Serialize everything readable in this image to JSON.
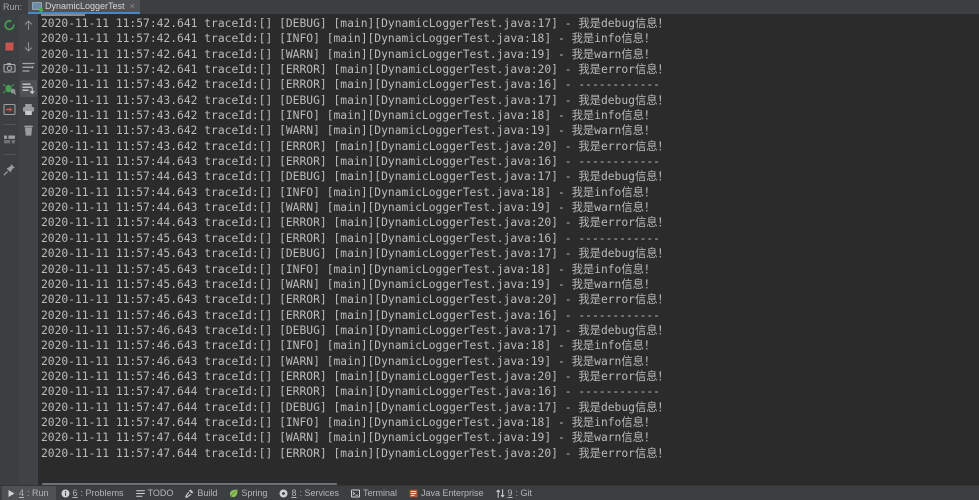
{
  "window": {
    "run_label": "Run:",
    "tab": {
      "title": "DynamicLoggerTest",
      "close": "×",
      "icon": "run-config-icon"
    }
  },
  "toolbar_left": {
    "buttons": [
      {
        "name": "rerun-button",
        "tooltip": "Rerun"
      },
      {
        "name": "stop-button",
        "tooltip": "Stop"
      },
      {
        "name": "screenshot-button",
        "tooltip": "Capture Screenshot"
      },
      {
        "name": "thread-dump-button",
        "tooltip": "Dump Threads"
      },
      {
        "name": "restore-layout-button",
        "tooltip": "Restore Layout"
      },
      {
        "name": "settings-button",
        "tooltip": "Settings"
      },
      {
        "name": "pin-tab-button",
        "tooltip": "Pin Tab"
      }
    ]
  },
  "toolbar_right": {
    "buttons": [
      {
        "name": "up-arrow-button",
        "tooltip": "Up the Stack Trace"
      },
      {
        "name": "down-arrow-button",
        "tooltip": "Down the Stack Trace"
      },
      {
        "name": "soft-wrap-button",
        "tooltip": "Use Soft Wraps"
      },
      {
        "name": "scroll-to-end-button",
        "tooltip": "Scroll to the end",
        "active": true
      },
      {
        "name": "print-button",
        "tooltip": "Print"
      },
      {
        "name": "clear-all-button",
        "tooltip": "Clear All"
      }
    ]
  },
  "console": {
    "date": "2020-11-11",
    "trace": "traceId:[]",
    "thread": "main",
    "file": "DynamicLoggerTest.java",
    "separator": " - ",
    "dashes": "------------",
    "lines": [
      {
        "ts": "2020-11-11 11:57:42.641",
        "trace": "traceId:[]",
        "level": "DEBUG",
        "src": "[main][DynamicLoggerTest.java:17]",
        "msg": "我是debug信息！"
      },
      {
        "ts": "2020-11-11 11:57:42.641",
        "trace": "traceId:[]",
        "level": "INFO",
        "src": "[main][DynamicLoggerTest.java:18]",
        "msg": "我是info信息！"
      },
      {
        "ts": "2020-11-11 11:57:42.641",
        "trace": "traceId:[]",
        "level": "WARN",
        "src": "[main][DynamicLoggerTest.java:19]",
        "msg": "我是warn信息！"
      },
      {
        "ts": "2020-11-11 11:57:42.641",
        "trace": "traceId:[]",
        "level": "ERROR",
        "src": "[main][DynamicLoggerTest.java:20]",
        "msg": "我是error信息！"
      },
      {
        "ts": "2020-11-11 11:57:43.642",
        "trace": "traceId:[]",
        "level": "ERROR",
        "src": "[main][DynamicLoggerTest.java:16]",
        "msg": "------------"
      },
      {
        "ts": "2020-11-11 11:57:43.642",
        "trace": "traceId:[]",
        "level": "DEBUG",
        "src": "[main][DynamicLoggerTest.java:17]",
        "msg": "我是debug信息！"
      },
      {
        "ts": "2020-11-11 11:57:43.642",
        "trace": "traceId:[]",
        "level": "INFO",
        "src": "[main][DynamicLoggerTest.java:18]",
        "msg": "我是info信息！"
      },
      {
        "ts": "2020-11-11 11:57:43.642",
        "trace": "traceId:[]",
        "level": "WARN",
        "src": "[main][DynamicLoggerTest.java:19]",
        "msg": "我是warn信息！"
      },
      {
        "ts": "2020-11-11 11:57:43.642",
        "trace": "traceId:[]",
        "level": "ERROR",
        "src": "[main][DynamicLoggerTest.java:20]",
        "msg": "我是error信息！"
      },
      {
        "ts": "2020-11-11 11:57:44.643",
        "trace": "traceId:[]",
        "level": "ERROR",
        "src": "[main][DynamicLoggerTest.java:16]",
        "msg": "------------"
      },
      {
        "ts": "2020-11-11 11:57:44.643",
        "trace": "traceId:[]",
        "level": "DEBUG",
        "src": "[main][DynamicLoggerTest.java:17]",
        "msg": "我是debug信息！"
      },
      {
        "ts": "2020-11-11 11:57:44.643",
        "trace": "traceId:[]",
        "level": "INFO",
        "src": "[main][DynamicLoggerTest.java:18]",
        "msg": "我是info信息！"
      },
      {
        "ts": "2020-11-11 11:57:44.643",
        "trace": "traceId:[]",
        "level": "WARN",
        "src": "[main][DynamicLoggerTest.java:19]",
        "msg": "我是warn信息！"
      },
      {
        "ts": "2020-11-11 11:57:44.643",
        "trace": "traceId:[]",
        "level": "ERROR",
        "src": "[main][DynamicLoggerTest.java:20]",
        "msg": "我是error信息！"
      },
      {
        "ts": "2020-11-11 11:57:45.643",
        "trace": "traceId:[]",
        "level": "ERROR",
        "src": "[main][DynamicLoggerTest.java:16]",
        "msg": "------------"
      },
      {
        "ts": "2020-11-11 11:57:45.643",
        "trace": "traceId:[]",
        "level": "DEBUG",
        "src": "[main][DynamicLoggerTest.java:17]",
        "msg": "我是debug信息！"
      },
      {
        "ts": "2020-11-11 11:57:45.643",
        "trace": "traceId:[]",
        "level": "INFO",
        "src": "[main][DynamicLoggerTest.java:18]",
        "msg": "我是info信息！"
      },
      {
        "ts": "2020-11-11 11:57:45.643",
        "trace": "traceId:[]",
        "level": "WARN",
        "src": "[main][DynamicLoggerTest.java:19]",
        "msg": "我是warn信息！"
      },
      {
        "ts": "2020-11-11 11:57:45.643",
        "trace": "traceId:[]",
        "level": "ERROR",
        "src": "[main][DynamicLoggerTest.java:20]",
        "msg": "我是error信息！"
      },
      {
        "ts": "2020-11-11 11:57:46.643",
        "trace": "traceId:[]",
        "level": "ERROR",
        "src": "[main][DynamicLoggerTest.java:16]",
        "msg": "------------"
      },
      {
        "ts": "2020-11-11 11:57:46.643",
        "trace": "traceId:[]",
        "level": "DEBUG",
        "src": "[main][DynamicLoggerTest.java:17]",
        "msg": "我是debug信息！"
      },
      {
        "ts": "2020-11-11 11:57:46.643",
        "trace": "traceId:[]",
        "level": "INFO",
        "src": "[main][DynamicLoggerTest.java:18]",
        "msg": "我是info信息！"
      },
      {
        "ts": "2020-11-11 11:57:46.643",
        "trace": "traceId:[]",
        "level": "WARN",
        "src": "[main][DynamicLoggerTest.java:19]",
        "msg": "我是warn信息！"
      },
      {
        "ts": "2020-11-11 11:57:46.643",
        "trace": "traceId:[]",
        "level": "ERROR",
        "src": "[main][DynamicLoggerTest.java:20]",
        "msg": "我是error信息！"
      },
      {
        "ts": "2020-11-11 11:57:47.644",
        "trace": "traceId:[]",
        "level": "ERROR",
        "src": "[main][DynamicLoggerTest.java:16]",
        "msg": "------------"
      },
      {
        "ts": "2020-11-11 11:57:47.644",
        "trace": "traceId:[]",
        "level": "DEBUG",
        "src": "[main][DynamicLoggerTest.java:17]",
        "msg": "我是debug信息！"
      },
      {
        "ts": "2020-11-11 11:57:47.644",
        "trace": "traceId:[]",
        "level": "INFO",
        "src": "[main][DynamicLoggerTest.java:18]",
        "msg": "我是info信息！"
      },
      {
        "ts": "2020-11-11 11:57:47.644",
        "trace": "traceId:[]",
        "level": "WARN",
        "src": "[main][DynamicLoggerTest.java:19]",
        "msg": "我是warn信息！"
      },
      {
        "ts": "2020-11-11 11:57:47.644",
        "trace": "traceId:[]",
        "level": "ERROR",
        "src": "[main][DynamicLoggerTest.java:20]",
        "msg": "我是error信息！"
      }
    ]
  },
  "statusbar": {
    "items": [
      {
        "name": "status-run",
        "mnemonic": "4",
        "label": ": Run",
        "icon": "play-icon",
        "selected": true
      },
      {
        "name": "status-problems",
        "mnemonic": "6",
        "label": ": Problems",
        "icon": "info-icon",
        "selected": false
      },
      {
        "name": "status-todo",
        "mnemonic": "",
        "label": "TODO",
        "icon": "list-icon",
        "selected": false
      },
      {
        "name": "status-build",
        "mnemonic": "",
        "label": "Build",
        "icon": "hammer-icon",
        "selected": false
      },
      {
        "name": "status-spring",
        "mnemonic": "",
        "label": "Spring",
        "icon": "leaf-icon",
        "selected": false
      },
      {
        "name": "status-services",
        "mnemonic": "8",
        "label": ": Services",
        "icon": "services-icon",
        "selected": false
      },
      {
        "name": "status-terminal",
        "mnemonic": "",
        "label": "Terminal",
        "icon": "terminal-icon",
        "selected": false
      },
      {
        "name": "status-java-enterprise",
        "mnemonic": "",
        "label": "Java Enterprise",
        "icon": "java-ee-icon",
        "selected": false
      },
      {
        "name": "status-git",
        "mnemonic": "9",
        "label": ": Git",
        "icon": "branch-icon",
        "selected": false
      }
    ]
  },
  "colors": {
    "console_bg": "#2b2b2b",
    "chrome_bg": "#3c3f41",
    "text": "#bbbbbb",
    "tab_accent": "#4a88c7",
    "stop_red": "#c75450",
    "run_green": "#499c54"
  }
}
